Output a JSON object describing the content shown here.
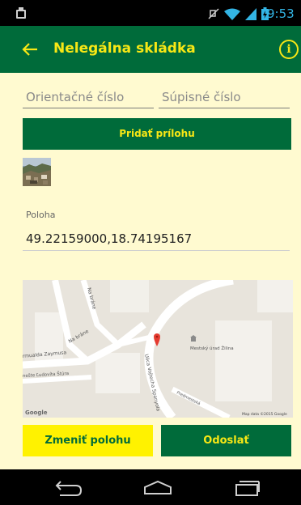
{
  "status_bar": {
    "time": "9:53"
  },
  "app_bar": {
    "title": "Nelegálna skládka",
    "info_glyph": "i"
  },
  "form": {
    "orientation_number_placeholder": "Orientačné číslo",
    "registry_number_placeholder": "Súpisné číslo",
    "attach_button_label": "Pridať prílohu",
    "location_label": "Poloha",
    "location_value": "49.22159000,18.74195167"
  },
  "map": {
    "labels": {
      "street_na_brane": "Na bráne",
      "street_na_brane_2": "Na bráne",
      "street_zaymusa": "rmualda Zaymusa",
      "street_stura": "nešte Ľudovíta Štúra",
      "street_sporovej": "Ulica Vojtecha Spanyola",
      "street_predmestska": "Predmestská",
      "poi_office": "Mestský úrad Žilina",
      "logo": "Google",
      "attribution": "Map data ©2015 Google"
    }
  },
  "actions": {
    "change_location_label": "Zmeniť polohu",
    "send_label": "Odoslať"
  },
  "icons": {
    "back": "arrow-left-icon",
    "info": "info-icon",
    "map_pin": "map-pin-icon",
    "poi": "building-icon",
    "nav_back": "nav-back-icon",
    "nav_home": "nav-home-icon",
    "nav_recents": "nav-recents-icon"
  },
  "colors": {
    "primary": "#006b3a",
    "accent": "#f7e715",
    "background": "#fffad0",
    "secondary_button": "#fff200"
  }
}
